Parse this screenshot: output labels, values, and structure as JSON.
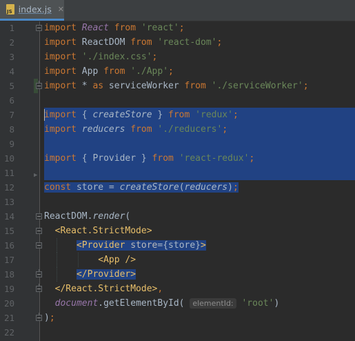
{
  "tab": {
    "label": "index.js",
    "icon": "js-file-icon",
    "close": "✕",
    "icon_text": "JS"
  },
  "editor": {
    "line_numbers": [
      "1",
      "2",
      "3",
      "4",
      "5",
      "6",
      "7",
      "8",
      "9",
      "10",
      "11",
      "12",
      "13",
      "14",
      "15",
      "16",
      "17",
      "18",
      "19",
      "20",
      "21",
      "22"
    ],
    "hint_label": "elementId:"
  },
  "colors": {
    "selection": "#214283",
    "keyword": "#cc7832",
    "string": "#6a8759",
    "identifier_italic": "#9876aa",
    "tag": "#e8bf6a"
  }
}
